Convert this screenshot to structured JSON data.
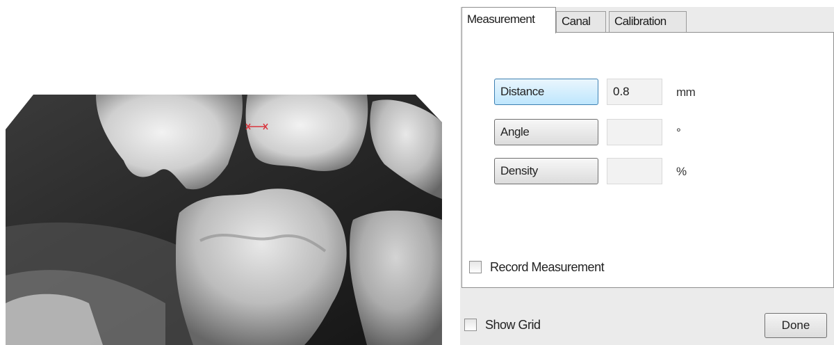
{
  "tabs": [
    {
      "label": "Measurement",
      "active": true
    },
    {
      "label": "Canal",
      "active": false
    },
    {
      "label": "Calibration",
      "active": false
    }
  ],
  "measurement": {
    "distance": {
      "label": "Distance",
      "value": "0.8",
      "unit": "mm",
      "active": true
    },
    "angle": {
      "label": "Angle",
      "value": "",
      "unit": "°"
    },
    "density": {
      "label": "Density",
      "value": "",
      "unit": "%"
    }
  },
  "record_measurement": {
    "label": "Record Measurement",
    "checked": false
  },
  "show_grid": {
    "label": "Show Grid",
    "checked": false
  },
  "done_label": "Done",
  "colors": {
    "measure_marker": "#d9363e",
    "active_button": "#bee6fd"
  }
}
